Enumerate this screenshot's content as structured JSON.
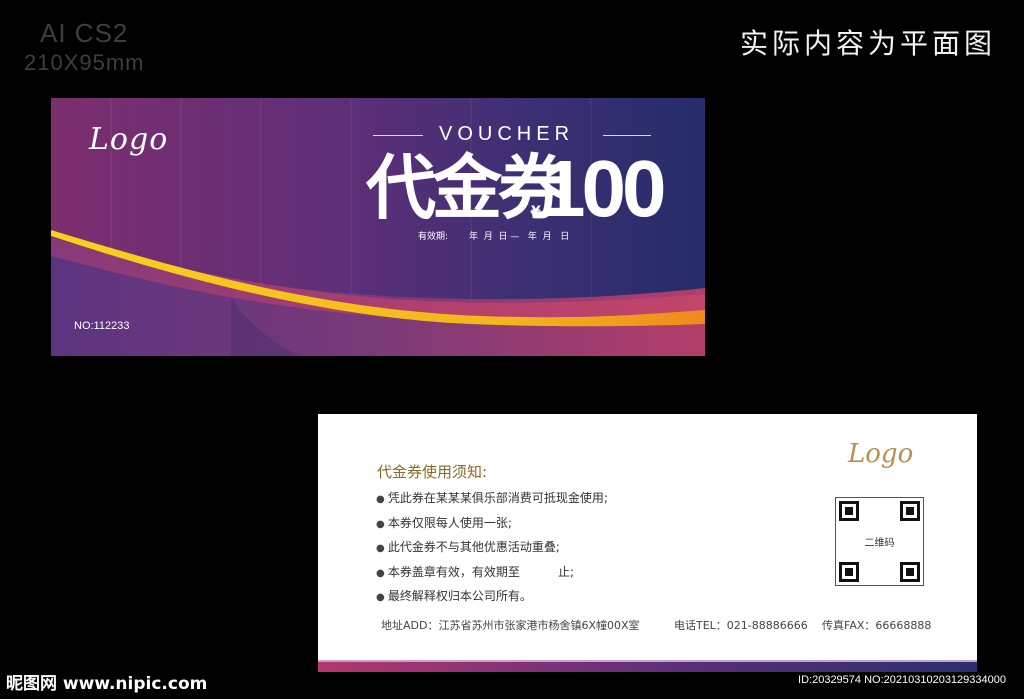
{
  "header": {
    "software": "AI CS2",
    "size": "210X95mm",
    "note": "实际内容为平面图"
  },
  "front": {
    "logo": "Logo",
    "voucher_word": "VOUCHER",
    "title": "代金券",
    "currency": "¥",
    "amount": "100",
    "valid_label": "有效期:",
    "valid_dates": "年  月  日 —   年  月   日",
    "serial": "NO:112233",
    "colors": {
      "left": "#7c2e6e",
      "right": "#262d69",
      "gold": "#f3c21e",
      "orange": "#f08a1c"
    }
  },
  "back": {
    "logo": "Logo",
    "heading": "代金券使用须知:",
    "rules": [
      "凭此券在某某某俱乐部消费可抵现金使用;",
      "本券仅限每人使用一张;",
      "此代金券不与其他优惠活动重叠;",
      "本券盖章有效，有效期至          止;",
      "最终解释权归本公司所有。"
    ],
    "qr_label": "二维码",
    "address": "地址ADD：江苏省苏州市张家港市杨舍镇6X幢00X室",
    "tel": "电话TEL：021-88886666",
    "fax": "传真FAX：66668888"
  },
  "watermark": {
    "site": "昵图网 www.nipic.com",
    "id": "ID:20329574 NO:20210310203129334000"
  }
}
